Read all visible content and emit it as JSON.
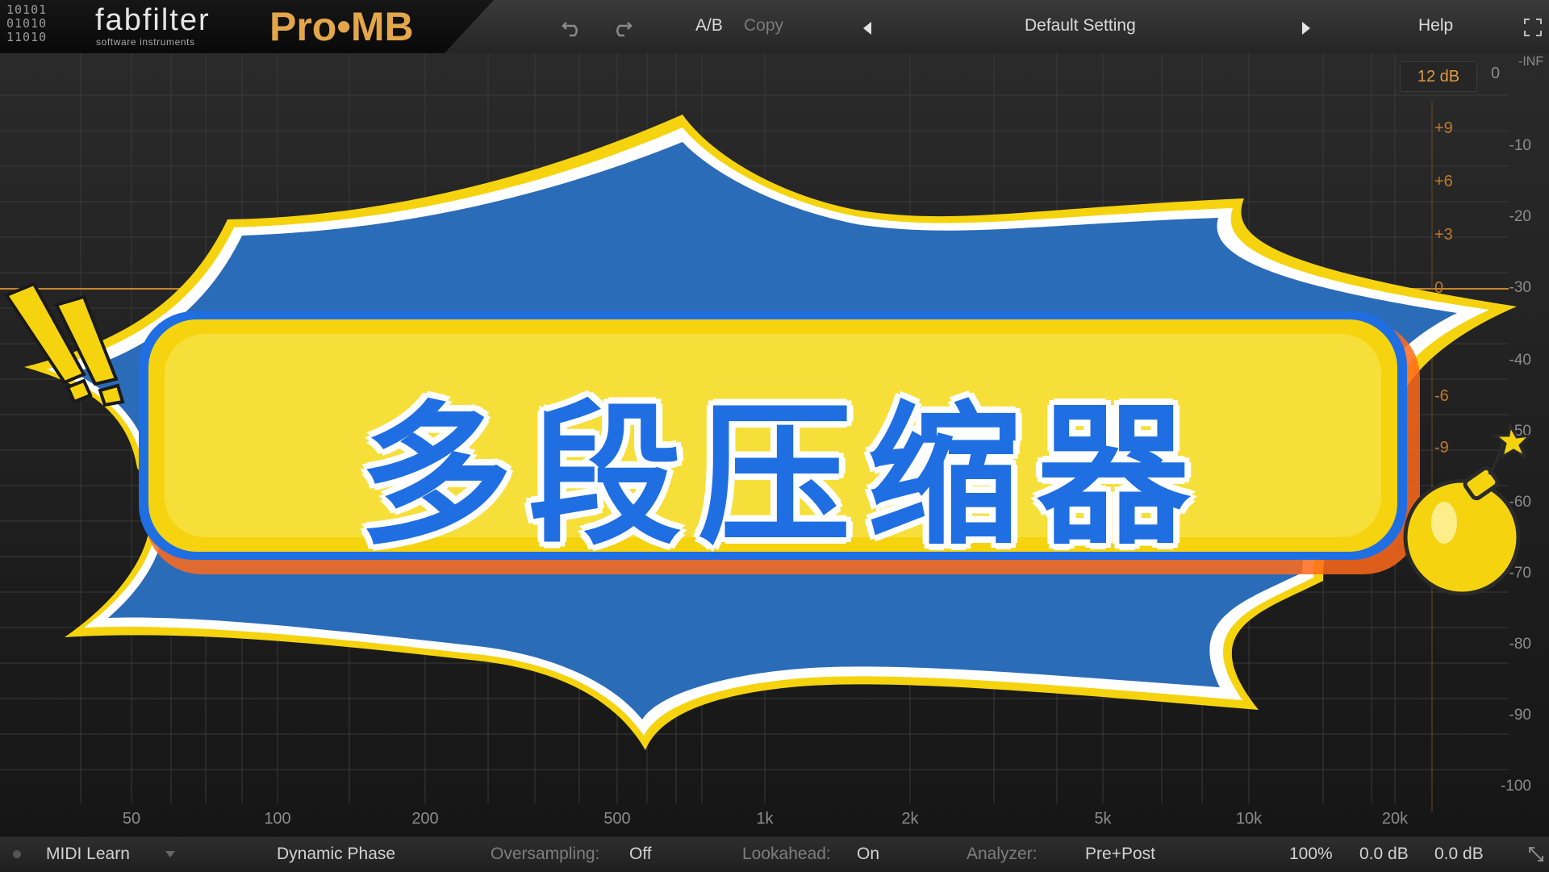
{
  "header": {
    "logo_bits": "10101\n01010\n11010",
    "brand": "fabfilter",
    "brand_sub": "software instruments",
    "product": "Pro•MB",
    "undo_icon": "undo-icon",
    "redo_icon": "redo-icon",
    "ab_label": "A/B",
    "copy_label": "Copy",
    "preset_name": "Default Setting",
    "help_label": "Help"
  },
  "display": {
    "range_value": "12 dB",
    "inf_label": "-INF",
    "zero_label": "0",
    "level_scale": [
      "-10",
      "-20",
      "-30",
      "-40",
      "-50",
      "-60",
      "-70",
      "-80",
      "-90",
      "-100"
    ],
    "gain_scale": [
      "+9",
      "+6",
      "+3",
      "0",
      "-6",
      "-9"
    ],
    "freq_labels": [
      "50",
      "100",
      "200",
      "500",
      "1k",
      "2k",
      "5k",
      "10k",
      "20k"
    ]
  },
  "banner": {
    "title": "多段压缩器",
    "colors": {
      "burst": "#2b6cb8",
      "title": "#1f6fe3",
      "frame": "#f5d40f",
      "accent": "#ff6a1a"
    }
  },
  "footer": {
    "midi_learn": "MIDI Learn",
    "mode": "Dynamic Phase",
    "oversampling_label": "Oversampling:",
    "oversampling_value": "Off",
    "lookahead_label": "Lookahead:",
    "lookahead_value": "On",
    "analyzer_label": "Analyzer:",
    "analyzer_value": "Pre+Post",
    "zoom": "100%",
    "in_gain": "0.0 dB",
    "out_gain": "0.0 dB"
  },
  "colors": {
    "accent": "#e3a64a",
    "background": "#1b1b1b"
  }
}
